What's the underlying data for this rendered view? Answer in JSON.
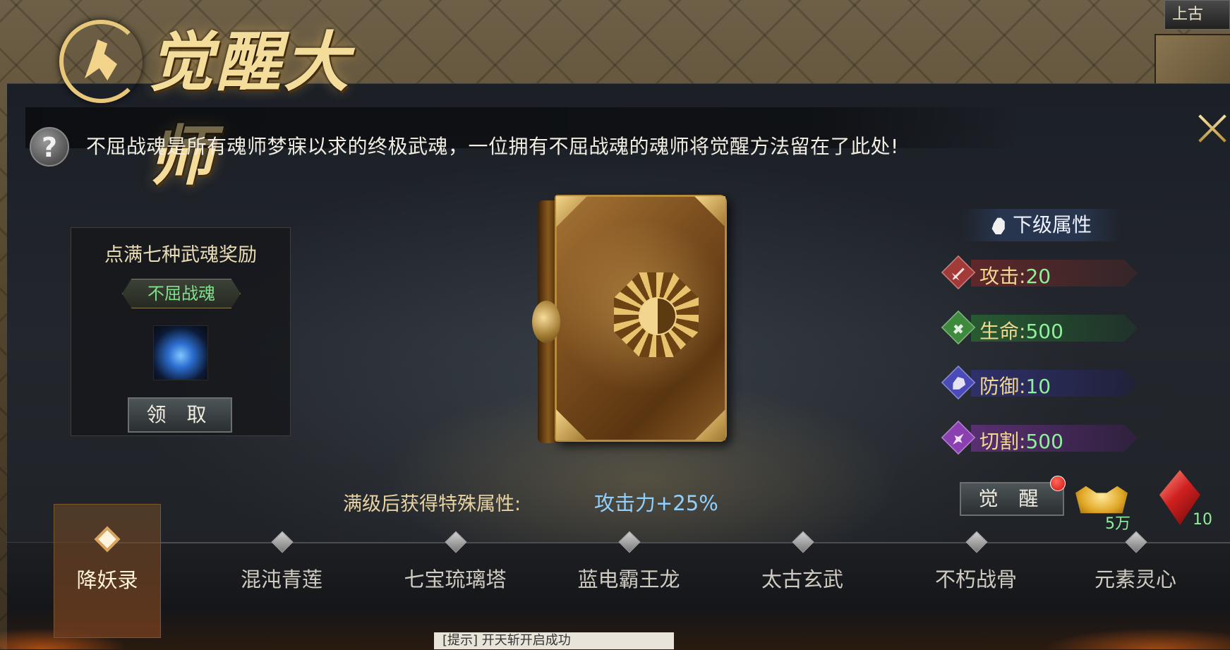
{
  "header": {
    "title": "觉醒大师",
    "top_right_label": "上古",
    "bottom_tip": "[提示] 开天斩开启成功"
  },
  "info": {
    "help_symbol": "?",
    "description": "不屈战魂是所有魂师梦寐以求的终极武魂，一位拥有不屈战魂的魂师将觉醒方法留在了此处!"
  },
  "reward": {
    "title": "点满七种武魂奖励",
    "item_name": "不屈战魂",
    "claim_label": "领 取"
  },
  "special": {
    "label": "满级后获得特殊属性:",
    "value": "攻击力+25%"
  },
  "attributes": {
    "header": "下级属性",
    "items": [
      {
        "name": "攻击:",
        "value": "20",
        "icon": "sword-icon",
        "color": "#a33a3a"
      },
      {
        "name": "生命:",
        "value": "500",
        "icon": "heal-cross-icon",
        "color": "#3d8a3d"
      },
      {
        "name": "防御:",
        "value": "10",
        "icon": "shield-icon",
        "color": "#4a4ab8"
      },
      {
        "name": "切割:",
        "value": "500",
        "icon": "cut-icon",
        "color": "#8a40b0"
      }
    ]
  },
  "awaken": {
    "button_label": "觉 醒",
    "gold_count": "5万",
    "gem_count": "10"
  },
  "tabs": [
    {
      "label": "降妖录",
      "active": true
    },
    {
      "label": "混沌青莲"
    },
    {
      "label": "七宝琉璃塔"
    },
    {
      "label": "蓝电霸王龙"
    },
    {
      "label": "太古玄武"
    },
    {
      "label": "不朽战骨"
    },
    {
      "label": "元素灵心"
    }
  ],
  "colors": {
    "accent_gold": "#f2d88f",
    "value_green": "#8ef09a",
    "special_blue": "#8fd0ff"
  }
}
